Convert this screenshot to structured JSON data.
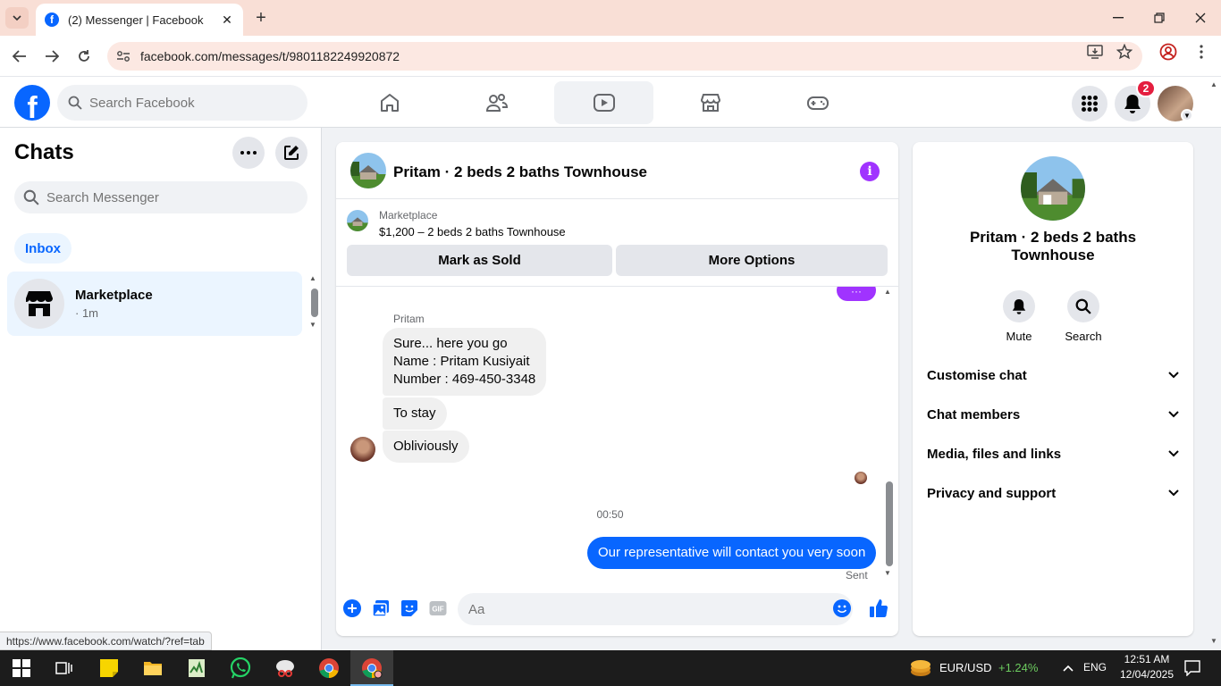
{
  "browser": {
    "tab_title": "(2) Messenger | Facebook",
    "url": "facebook.com/messages/t/9801182249920872",
    "status_url": "https://www.facebook.com/watch/?ref=tab"
  },
  "fb_header": {
    "search_placeholder": "Search Facebook",
    "notification_count": "2",
    "nav_items": [
      "home-icon",
      "friends-icon",
      "watch-icon",
      "marketplace-icon",
      "gaming-icon"
    ],
    "active_nav": "watch"
  },
  "sidebar": {
    "title": "Chats",
    "search_placeholder": "Search Messenger",
    "filter_chip": "Inbox",
    "chats": [
      {
        "name": "Marketplace",
        "time": "· 1m"
      }
    ]
  },
  "conversation": {
    "title": "Pritam · 2 beds 2 baths Townhouse",
    "marketplace_label": "Marketplace",
    "listing": "$1,200 – 2 beds 2 baths Townhouse",
    "mark_sold_label": "Mark as Sold",
    "more_options_label": "More Options",
    "sender_name": "Pritam",
    "incoming_messages": [
      "Sure... here you go",
      "Name : Pritam Kusiyait",
      "Number : 469-450-3348",
      "To stay",
      "Obliviously"
    ],
    "timestamp": "00:50",
    "outgoing_message": "Our representative will contact you very soon",
    "sent_label": "Sent",
    "composer_placeholder": "Aa",
    "gif_label": "GIF"
  },
  "info_panel": {
    "title": "Pritam · 2 beds 2 baths Townhouse",
    "actions": [
      "Mute",
      "Search"
    ],
    "sections": [
      "Customise chat",
      "Chat members",
      "Media, files and links",
      "Privacy and support"
    ]
  },
  "taskbar": {
    "ticker_label": "EUR/USD",
    "ticker_change": "+1.24%",
    "language": "ENG",
    "time": "12:51 AM",
    "date": "12/04/2025"
  },
  "colors": {
    "fb_blue": "#0866ff",
    "accent_purple": "#a033ff",
    "tab_bar": "#f9dfd6",
    "ticker_green": "#6ccb5f"
  }
}
